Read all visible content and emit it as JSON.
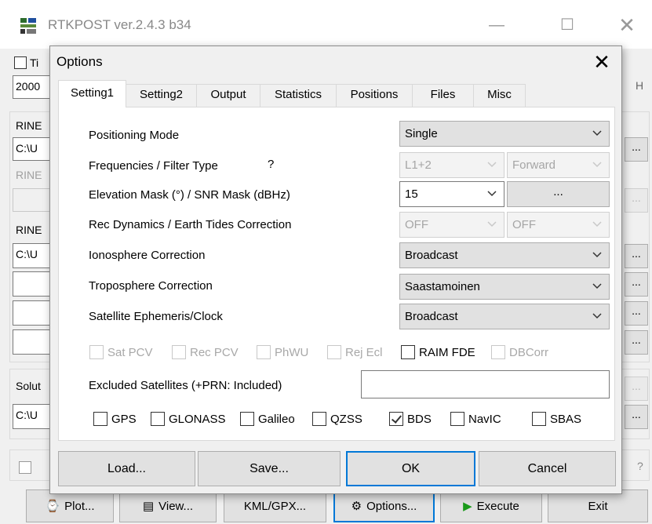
{
  "main": {
    "title": "RTKPOST ver.2.4.3 b34",
    "time_start_checkbox_label": "Ti",
    "time_start_value": "2000",
    "time_end_unit": "H",
    "rover_label": "RINE",
    "rover_path": "C:\\U",
    "base_label": "RINE",
    "nav_label": "RINE",
    "nav_path": "C:\\U",
    "solution_label": "Solut",
    "solution_path": "C:\\U",
    "browse_label": "...",
    "help_label": "?",
    "buttons": {
      "plot": "Plot...",
      "view": "View...",
      "kml": "KML/GPX...",
      "options": "Options...",
      "execute": "Execute",
      "exit": "Exit"
    }
  },
  "dialog": {
    "title": "Options",
    "close_label": "✕",
    "tabs": [
      "Setting1",
      "Setting2",
      "Output",
      "Statistics",
      "Positions",
      "Files",
      "Misc"
    ],
    "labels": {
      "positioning_mode": "Positioning Mode",
      "frequencies": "Frequencies / Filter Type",
      "freq_help": "?",
      "elevation_mask": "Elevation Mask (°) / SNR Mask (dBHz)",
      "rec_dynamics": "Rec Dynamics / Earth Tides Correction",
      "ionosphere": "Ionosphere Correction",
      "troposphere": "Troposphere Correction",
      "ephemeris": "Satellite Ephemeris/Clock",
      "excluded": "Excluded Satellites (+PRN: Included)"
    },
    "values": {
      "positioning_mode": "Single",
      "frequencies": "L1+2",
      "filter_type": "Forward",
      "elevation_mask": "15",
      "snr_mask_button": "...",
      "rec_dynamics": "OFF",
      "earth_tides": "OFF",
      "ionosphere": "Broadcast",
      "troposphere": "Saastamoinen",
      "ephemeris": "Broadcast",
      "excluded": ""
    },
    "options": [
      {
        "label": "Sat PCV",
        "checked": false,
        "enabled": false
      },
      {
        "label": "Rec PCV",
        "checked": false,
        "enabled": false
      },
      {
        "label": "PhWU",
        "checked": false,
        "enabled": false
      },
      {
        "label": "Rej Ecl",
        "checked": false,
        "enabled": false
      },
      {
        "label": "RAIM FDE",
        "checked": false,
        "enabled": true
      },
      {
        "label": "DBCorr",
        "checked": false,
        "enabled": false
      }
    ],
    "systems": [
      {
        "label": "GPS",
        "checked": false
      },
      {
        "label": "GLONASS",
        "checked": false
      },
      {
        "label": "Galileo",
        "checked": false
      },
      {
        "label": "QZSS",
        "checked": false
      },
      {
        "label": "BDS",
        "checked": true
      },
      {
        "label": "NavIC",
        "checked": false
      },
      {
        "label": "SBAS",
        "checked": false
      }
    ],
    "buttons": {
      "load": "Load...",
      "save": "Save...",
      "ok": "OK",
      "cancel": "Cancel"
    }
  }
}
